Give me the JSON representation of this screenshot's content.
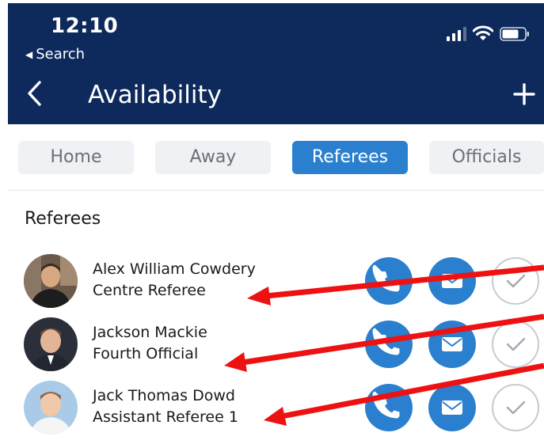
{
  "status_bar": {
    "time": "12:10",
    "back_app_label": "Search",
    "icons": [
      "cellular-signal-icon",
      "wifi-icon",
      "battery-icon"
    ]
  },
  "nav": {
    "title": "Availability",
    "back_icon": "chevron-left-icon",
    "add_icon": "plus-icon"
  },
  "tabs": [
    {
      "label": "Home",
      "active": false
    },
    {
      "label": "Away",
      "active": false
    },
    {
      "label": "Referees",
      "active": true
    },
    {
      "label": "Officials",
      "active": false
    }
  ],
  "section": {
    "title": "Referees"
  },
  "people": [
    {
      "name": "Alex William Cowdery",
      "role": "Centre Referee"
    },
    {
      "name": "Jackson Mackie",
      "role": "Fourth Official"
    },
    {
      "name": "Jack Thomas Dowd",
      "role": "Assistant Referee 1"
    }
  ],
  "row_actions": [
    "phone-icon",
    "mail-icon",
    "checkmark-icon"
  ],
  "colors": {
    "header_bg": "#0e2a5c",
    "accent": "#2a7fce",
    "tab_inactive_bg": "#f0f1f5",
    "annotation_arrow": "#ee1111"
  }
}
